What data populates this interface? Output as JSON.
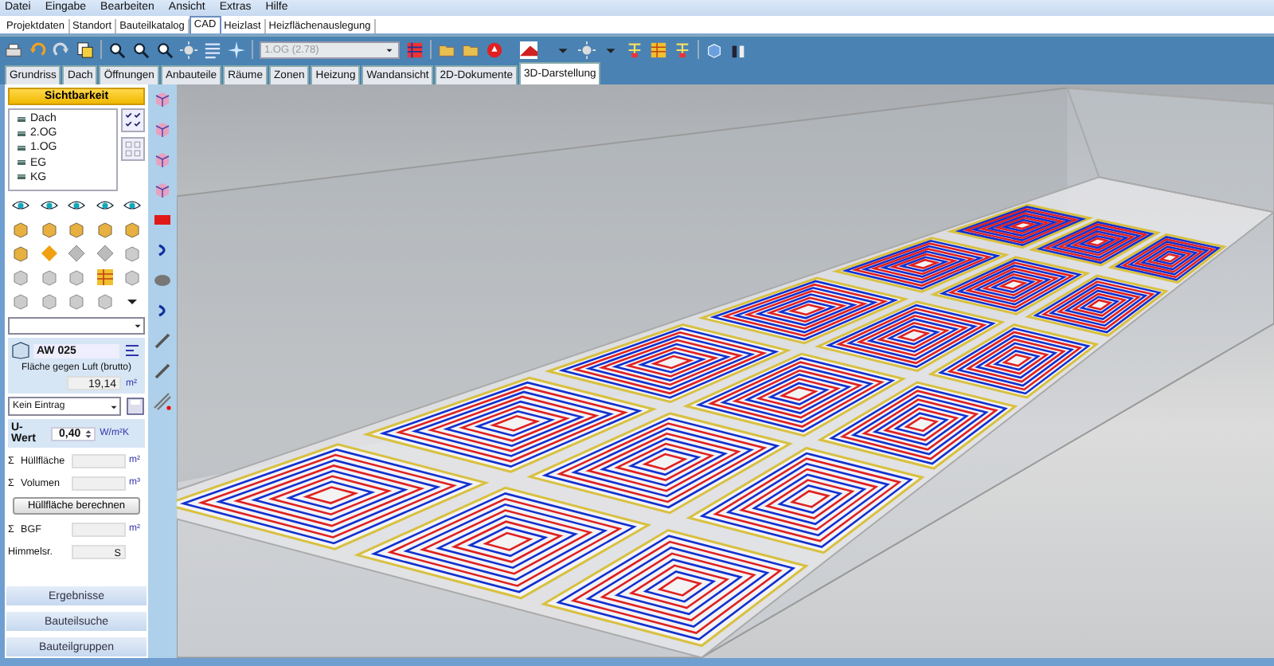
{
  "menu": [
    "Datei",
    "Eingabe",
    "Bearbeiten",
    "Ansicht",
    "Extras",
    "Hilfe"
  ],
  "main_tabs": [
    {
      "label": "Projektdaten",
      "selected": false
    },
    {
      "label": "Standort",
      "selected": false
    },
    {
      "label": "Bauteilkatalog",
      "selected": false
    },
    {
      "label": "CAD",
      "selected": true
    },
    {
      "label": "Heizlast",
      "selected": false
    },
    {
      "label": "Heizflächenauslegung",
      "selected": false
    }
  ],
  "toolbar": {
    "floor_select": "1.OG (2.78)"
  },
  "view_tabs": [
    {
      "label": "Grundriss",
      "selected": false
    },
    {
      "label": "Dach",
      "selected": false
    },
    {
      "label": "Öffnungen",
      "selected": false
    },
    {
      "label": "Anbauteile",
      "selected": false
    },
    {
      "label": "Räume",
      "selected": false
    },
    {
      "label": "Zonen",
      "selected": false
    },
    {
      "label": "Heizung",
      "selected": false
    },
    {
      "label": "Wandansicht",
      "selected": false
    },
    {
      "label": "2D-Dokumente",
      "selected": false
    },
    {
      "label": "3D-Darstellung",
      "selected": true
    }
  ],
  "sidebar": {
    "visibility_button": "Sichtbarkeit",
    "floors": [
      "Dach",
      "2.OG",
      "1.OG",
      "EG",
      "KG"
    ],
    "component": "AW 025",
    "area_label": "Fläche gegen Luft (brutto)",
    "area_value": "19,14",
    "area_unit": "m²",
    "entry_select": "Kein Eintrag",
    "u_label": "U-Wert",
    "u_value": "0,40",
    "u_unit": "W/m²K",
    "fields": [
      {
        "sigma": "Σ",
        "label": "Hüllfläche",
        "unit": "m²"
      },
      {
        "sigma": "Σ",
        "label": "Volumen",
        "unit": "m³"
      }
    ],
    "calc_button": "Hüllfläche berechnen",
    "bgf": {
      "sigma": "Σ",
      "label": "BGF",
      "unit": "m²"
    },
    "orientation": {
      "label": "Himmelsr.",
      "value": "S"
    },
    "bottom_buttons": [
      "Ergebnisse",
      "Bauteilsuche",
      "Bauteilgruppen"
    ]
  }
}
